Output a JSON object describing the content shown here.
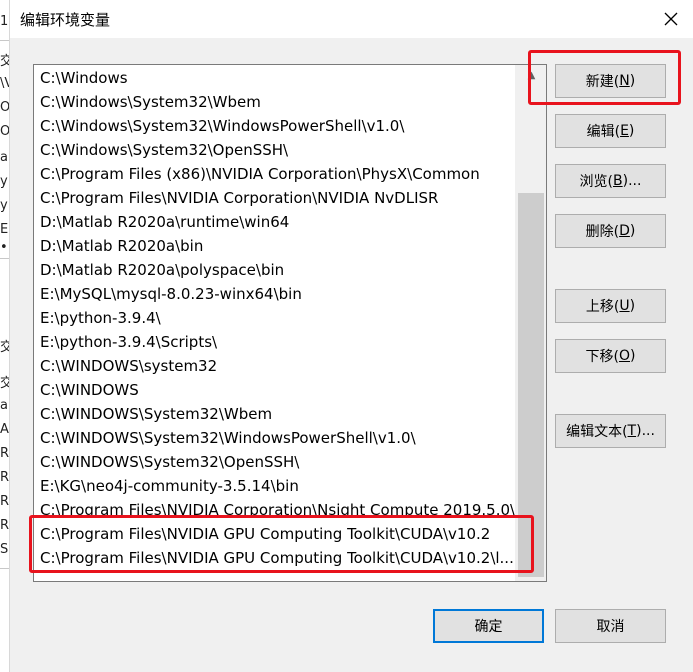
{
  "dialog": {
    "title": "编辑环境变量",
    "close_glyph": "✕"
  },
  "background_fragments": [
    "1 |",
    "交",
    "\\V",
    "Or",
    "Or",
    "a",
    "y",
    "y",
    "E",
    "•",
    "交",
    "交",
    "a",
    "A",
    "R",
    "R",
    "R",
    "R",
    "S"
  ],
  "path_list": {
    "items": [
      "C:\\Windows",
      "C:\\Windows\\System32\\Wbem",
      "C:\\Windows\\System32\\WindowsPowerShell\\v1.0\\",
      "C:\\Windows\\System32\\OpenSSH\\",
      "C:\\Program Files (x86)\\NVIDIA Corporation\\PhysX\\Common",
      "C:\\Program Files\\NVIDIA Corporation\\NVIDIA NvDLISR",
      "D:\\Matlab R2020a\\runtime\\win64",
      "D:\\Matlab R2020a\\bin",
      "D:\\Matlab R2020a\\polyspace\\bin",
      "E:\\MySQL\\mysql-8.0.23-winx64\\bin",
      "E:\\python-3.9.4\\",
      "E:\\python-3.9.4\\Scripts\\",
      "C:\\WINDOWS\\system32",
      "C:\\WINDOWS",
      "C:\\WINDOWS\\System32\\Wbem",
      "C:\\WINDOWS\\System32\\WindowsPowerShell\\v1.0\\",
      "C:\\WINDOWS\\System32\\OpenSSH\\",
      "E:\\KG\\neo4j-community-3.5.14\\bin",
      "C:\\Program Files\\NVIDIA Corporation\\Nsight Compute 2019.5.0\\",
      "C:\\Program Files\\NVIDIA GPU Computing Toolkit\\CUDA\\v10.2",
      "C:\\Program Files\\NVIDIA GPU Computing Toolkit\\CUDA\\v10.2\\l..."
    ],
    "scroll_up_glyph": "▲"
  },
  "buttons": {
    "new": {
      "label": "新建(",
      "key": "N",
      "tail": ")"
    },
    "edit": {
      "label": "编辑(",
      "key": "E",
      "tail": ")"
    },
    "browse": {
      "label": "浏览(",
      "key": "B",
      "tail": ")..."
    },
    "delete": {
      "label": "删除(",
      "key": "D",
      "tail": ")"
    },
    "move_up": {
      "label": "上移(",
      "key": "U",
      "tail": ")"
    },
    "move_down": {
      "label": "下移(",
      "key": "O",
      "tail": ")"
    },
    "edit_text": {
      "label": "编辑文本(",
      "key": "T",
      "tail": ")..."
    },
    "ok": "确定",
    "cancel": "取消"
  },
  "colors": {
    "highlight": "#e8131d",
    "focus": "#0078d7"
  }
}
